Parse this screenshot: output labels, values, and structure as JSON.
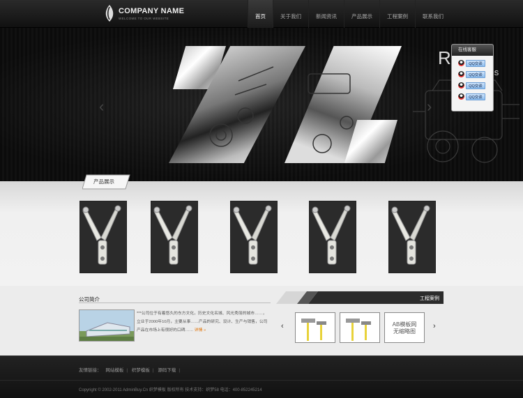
{
  "header": {
    "company_name": "COMPANY NAME",
    "tagline": "WELCOME TO OUR WEBSITE",
    "nav": [
      {
        "label": "首页",
        "active": true
      },
      {
        "label": "关于我们",
        "active": false
      },
      {
        "label": "新闻资讯",
        "active": false
      },
      {
        "label": "产品展示",
        "active": false
      },
      {
        "label": "工程案例",
        "active": false
      },
      {
        "label": "联系我们",
        "active": false
      }
    ]
  },
  "banner": {
    "big_text": "RICA",
    "sub_text": "ores",
    "prev_icon": "chevron-left-icon",
    "next_icon": "chevron-right-icon"
  },
  "online_service": {
    "title": "在线客服",
    "buttons": [
      "QQ交谈",
      "QQ交谈",
      "QQ交谈",
      "QQ交谈"
    ]
  },
  "products": {
    "title": "产品展示",
    "count": 5
  },
  "about": {
    "title": "公司简介",
    "text": "***公司位于有着悠久的东方文化，历史文化名城、风光秀丽的城市……，立业于2000年10月，主要从事……产品的研究、设计、生产与销售，公司产品在市场上有很好的口碑……",
    "more": "详情 »"
  },
  "cases": {
    "title": "工程案例",
    "ab_line1": "AB模板网",
    "ab_line2": "无缩略图"
  },
  "footer": {
    "links_label": "友情链接：",
    "links": [
      "网站模板",
      "织梦模板",
      "源码下载"
    ],
    "copyright": "Copyright © 2002-2011 AdminBuy.Cn 织梦模板 版权所有   技术支持：织梦58   电话：400-852245214"
  },
  "colors": {
    "accent_more": "#e07000",
    "qq_button": "#8fbff0"
  }
}
